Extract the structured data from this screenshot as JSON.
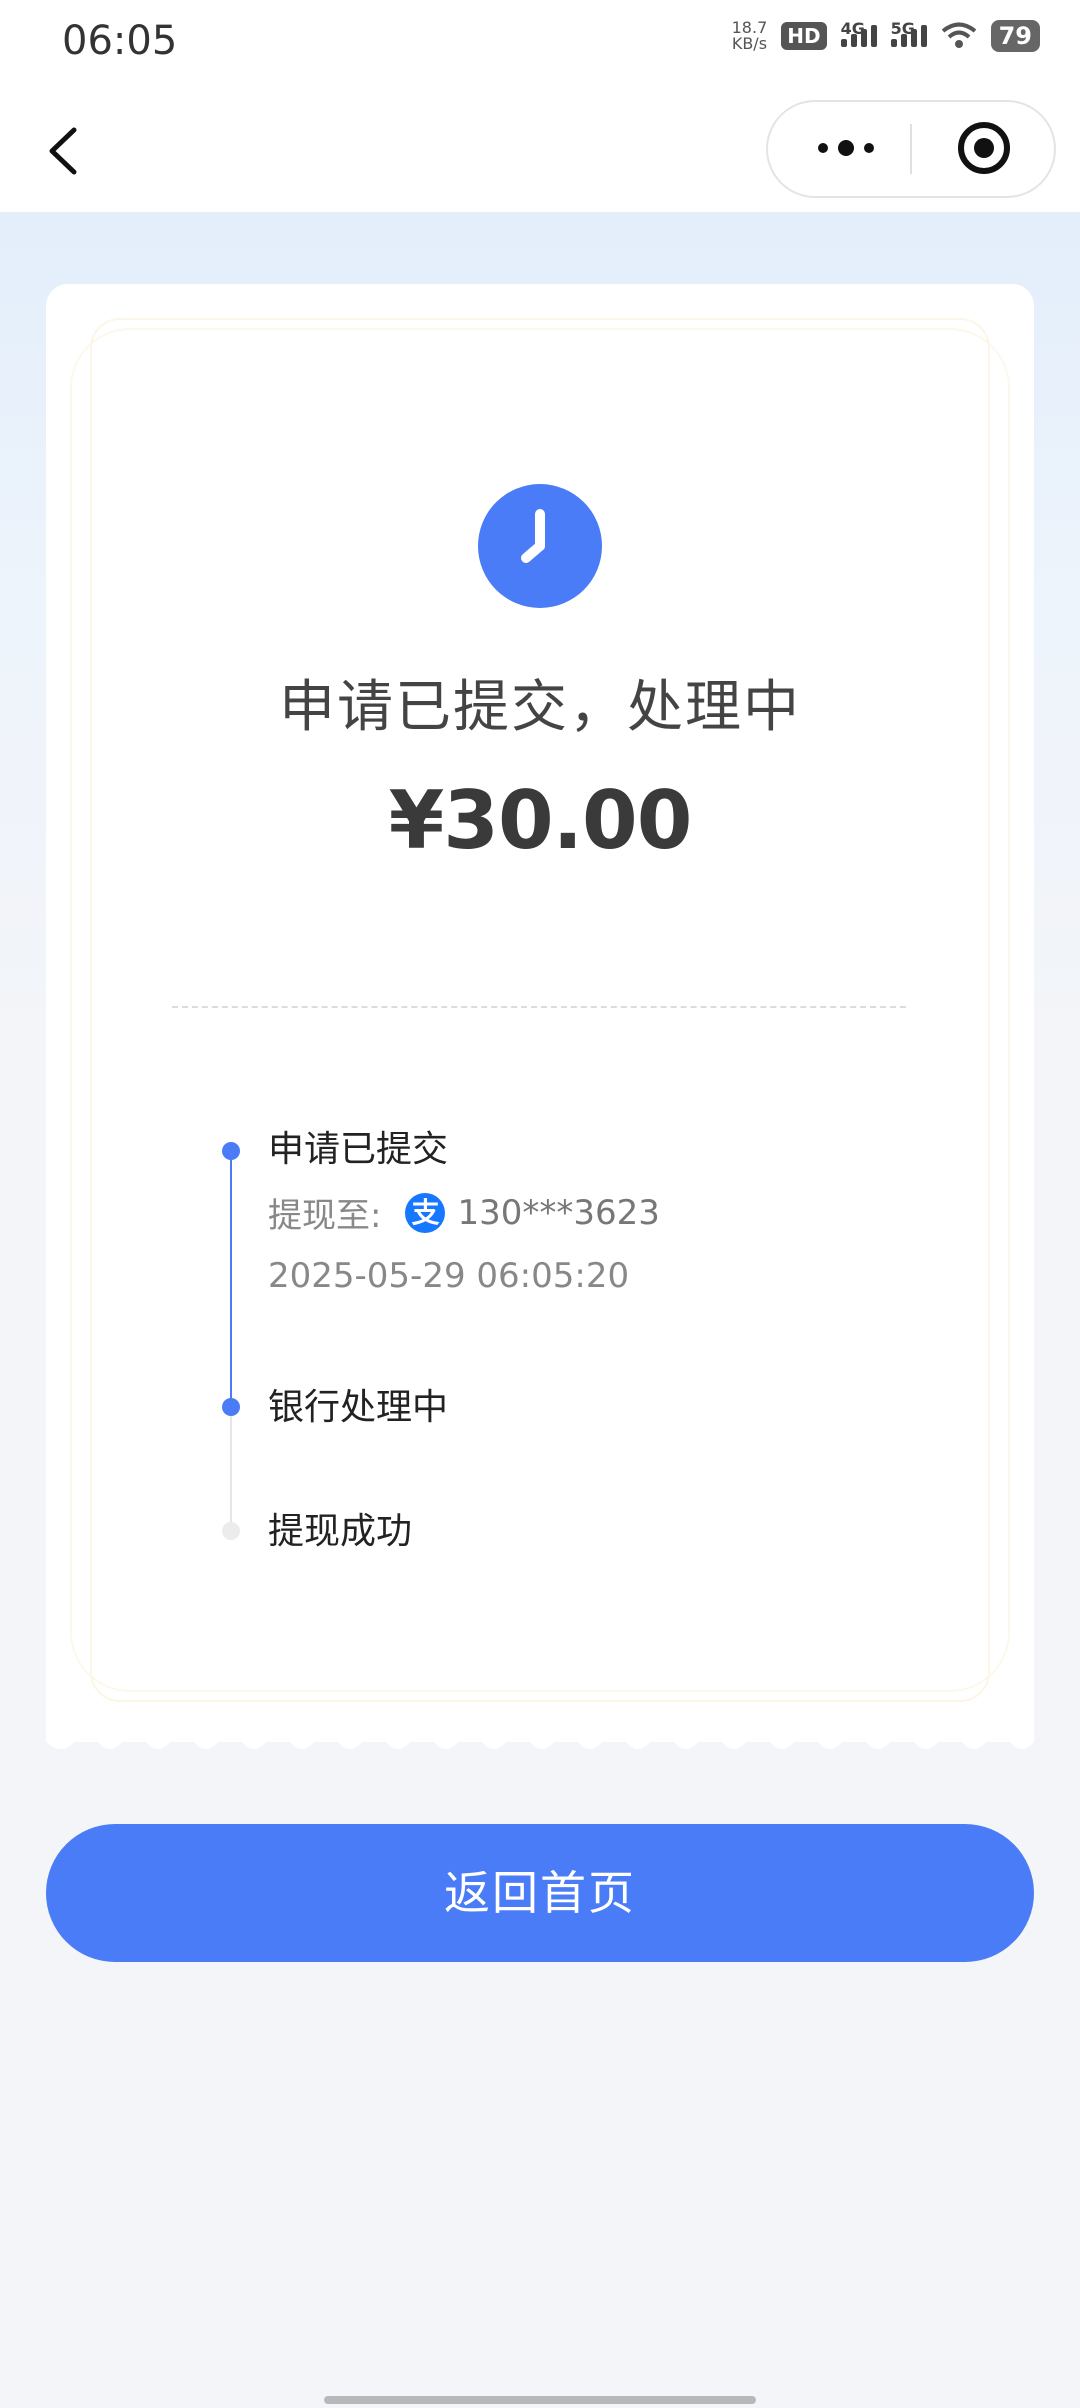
{
  "status_bar": {
    "time": "06:05",
    "net_speed_value": "18.7",
    "net_speed_unit": "KB/s",
    "hd_label": "HD",
    "signal1_label": "4G",
    "signal2_label": "5G",
    "battery": "79"
  },
  "nav": {
    "back_icon": "chevron-left-icon",
    "more_icon": "more-dots-icon",
    "close_icon": "target-circle-icon"
  },
  "result": {
    "status_icon": "clock-icon",
    "title": "申请已提交，处理中",
    "amount": "¥30.00"
  },
  "timeline": {
    "step1": {
      "label": "申请已提交",
      "withdraw_to_label": "提现至:",
      "account_icon": "alipay-icon",
      "account_icon_glyph": "支",
      "account": "130***3623",
      "timestamp": "2025-05-29 06:05:20"
    },
    "step2": {
      "label": "银行处理中"
    },
    "step3": {
      "label": "提现成功"
    }
  },
  "footer": {
    "home_button_label": "返回首页"
  },
  "colors": {
    "accent": "#4a7cf7",
    "alipay": "#1677ff",
    "inactive_dot": "#ececec"
  }
}
